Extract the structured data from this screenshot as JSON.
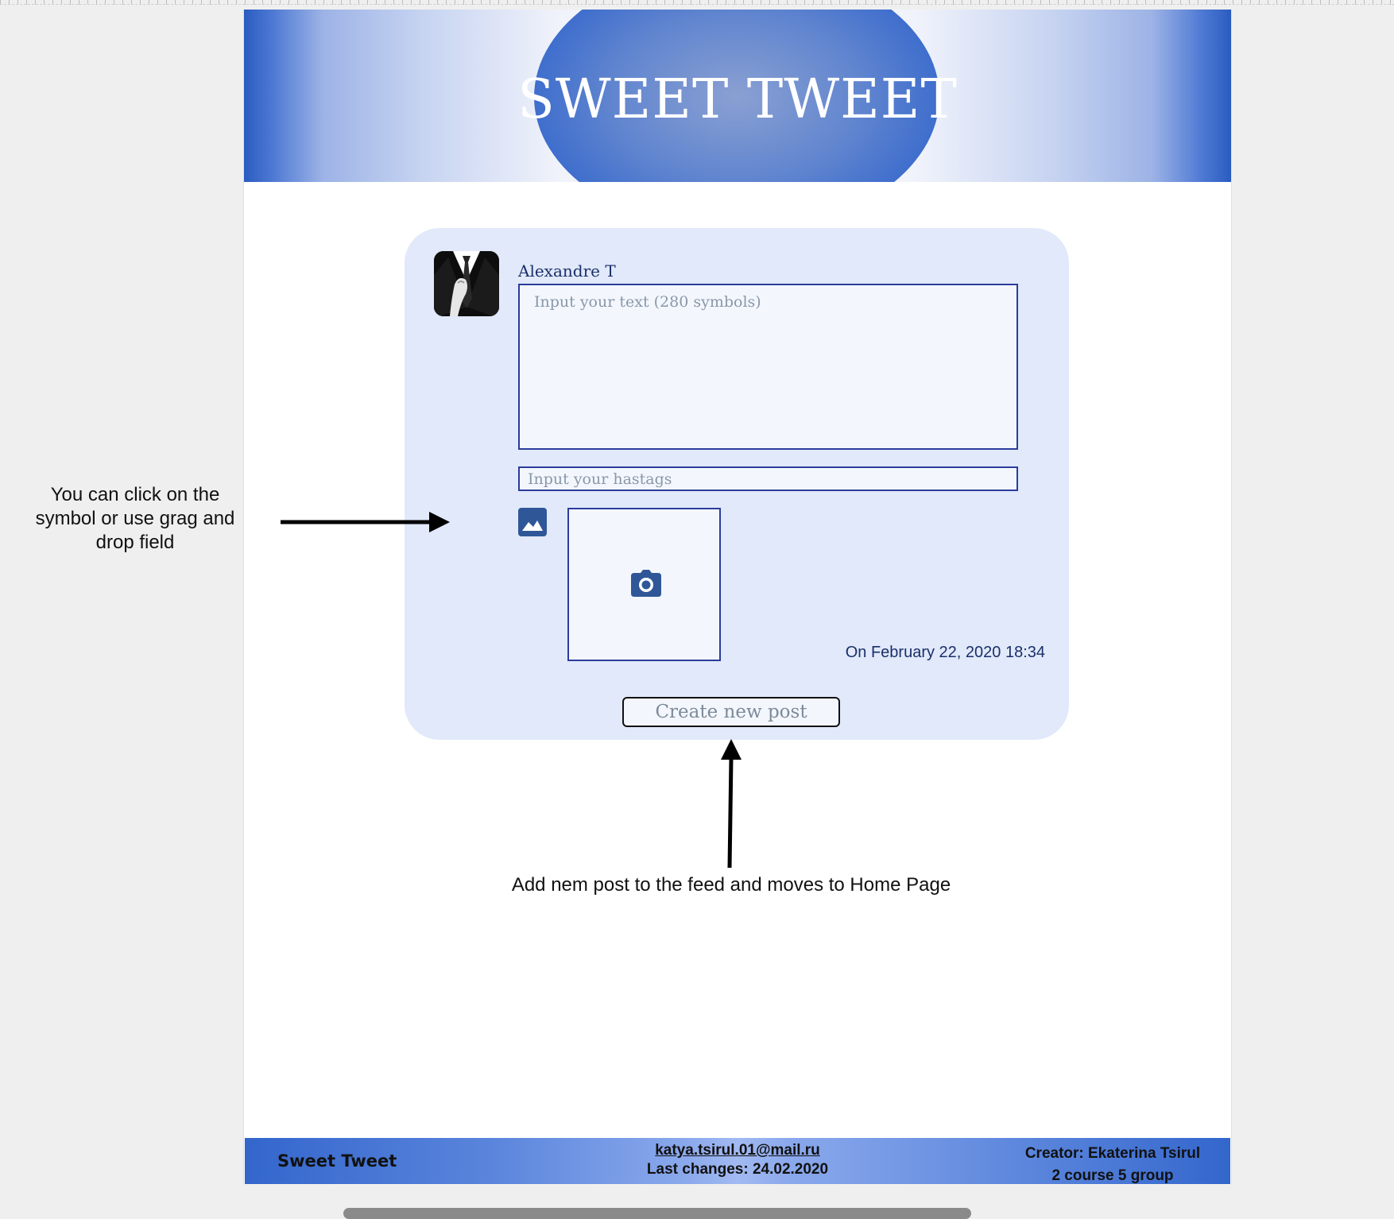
{
  "header": {
    "title": "SWEET TWEET"
  },
  "post_form": {
    "username": "Alexandre T",
    "text_placeholder": "Input your text (280 symbols)",
    "hashtags_placeholder": "Input your hastags",
    "date": "On February 22, 2020 18:34",
    "create_button_label": "Create new post",
    "icons": {
      "image": "image-icon",
      "camera": "camera-icon",
      "avatar": "avatar"
    }
  },
  "annotations": {
    "left_note": "You can click on the symbol or use grag and drop field",
    "bottom_note": "Add nem post to the feed and moves to Home Page"
  },
  "footer": {
    "brand": "Sweet Tweet",
    "email": "katya.tsirul.01@mail.ru",
    "last_changes": "Last changes: 24.02.2020",
    "creator": "Creator: Ekaterina Tsirul",
    "group": "2 course 5 group"
  },
  "colors": {
    "brand_blue": "#3366cc",
    "card_bg": "#e1e9fa",
    "border_blue": "#2b3c9a",
    "text_dark_blue": "#1a2f6a"
  }
}
